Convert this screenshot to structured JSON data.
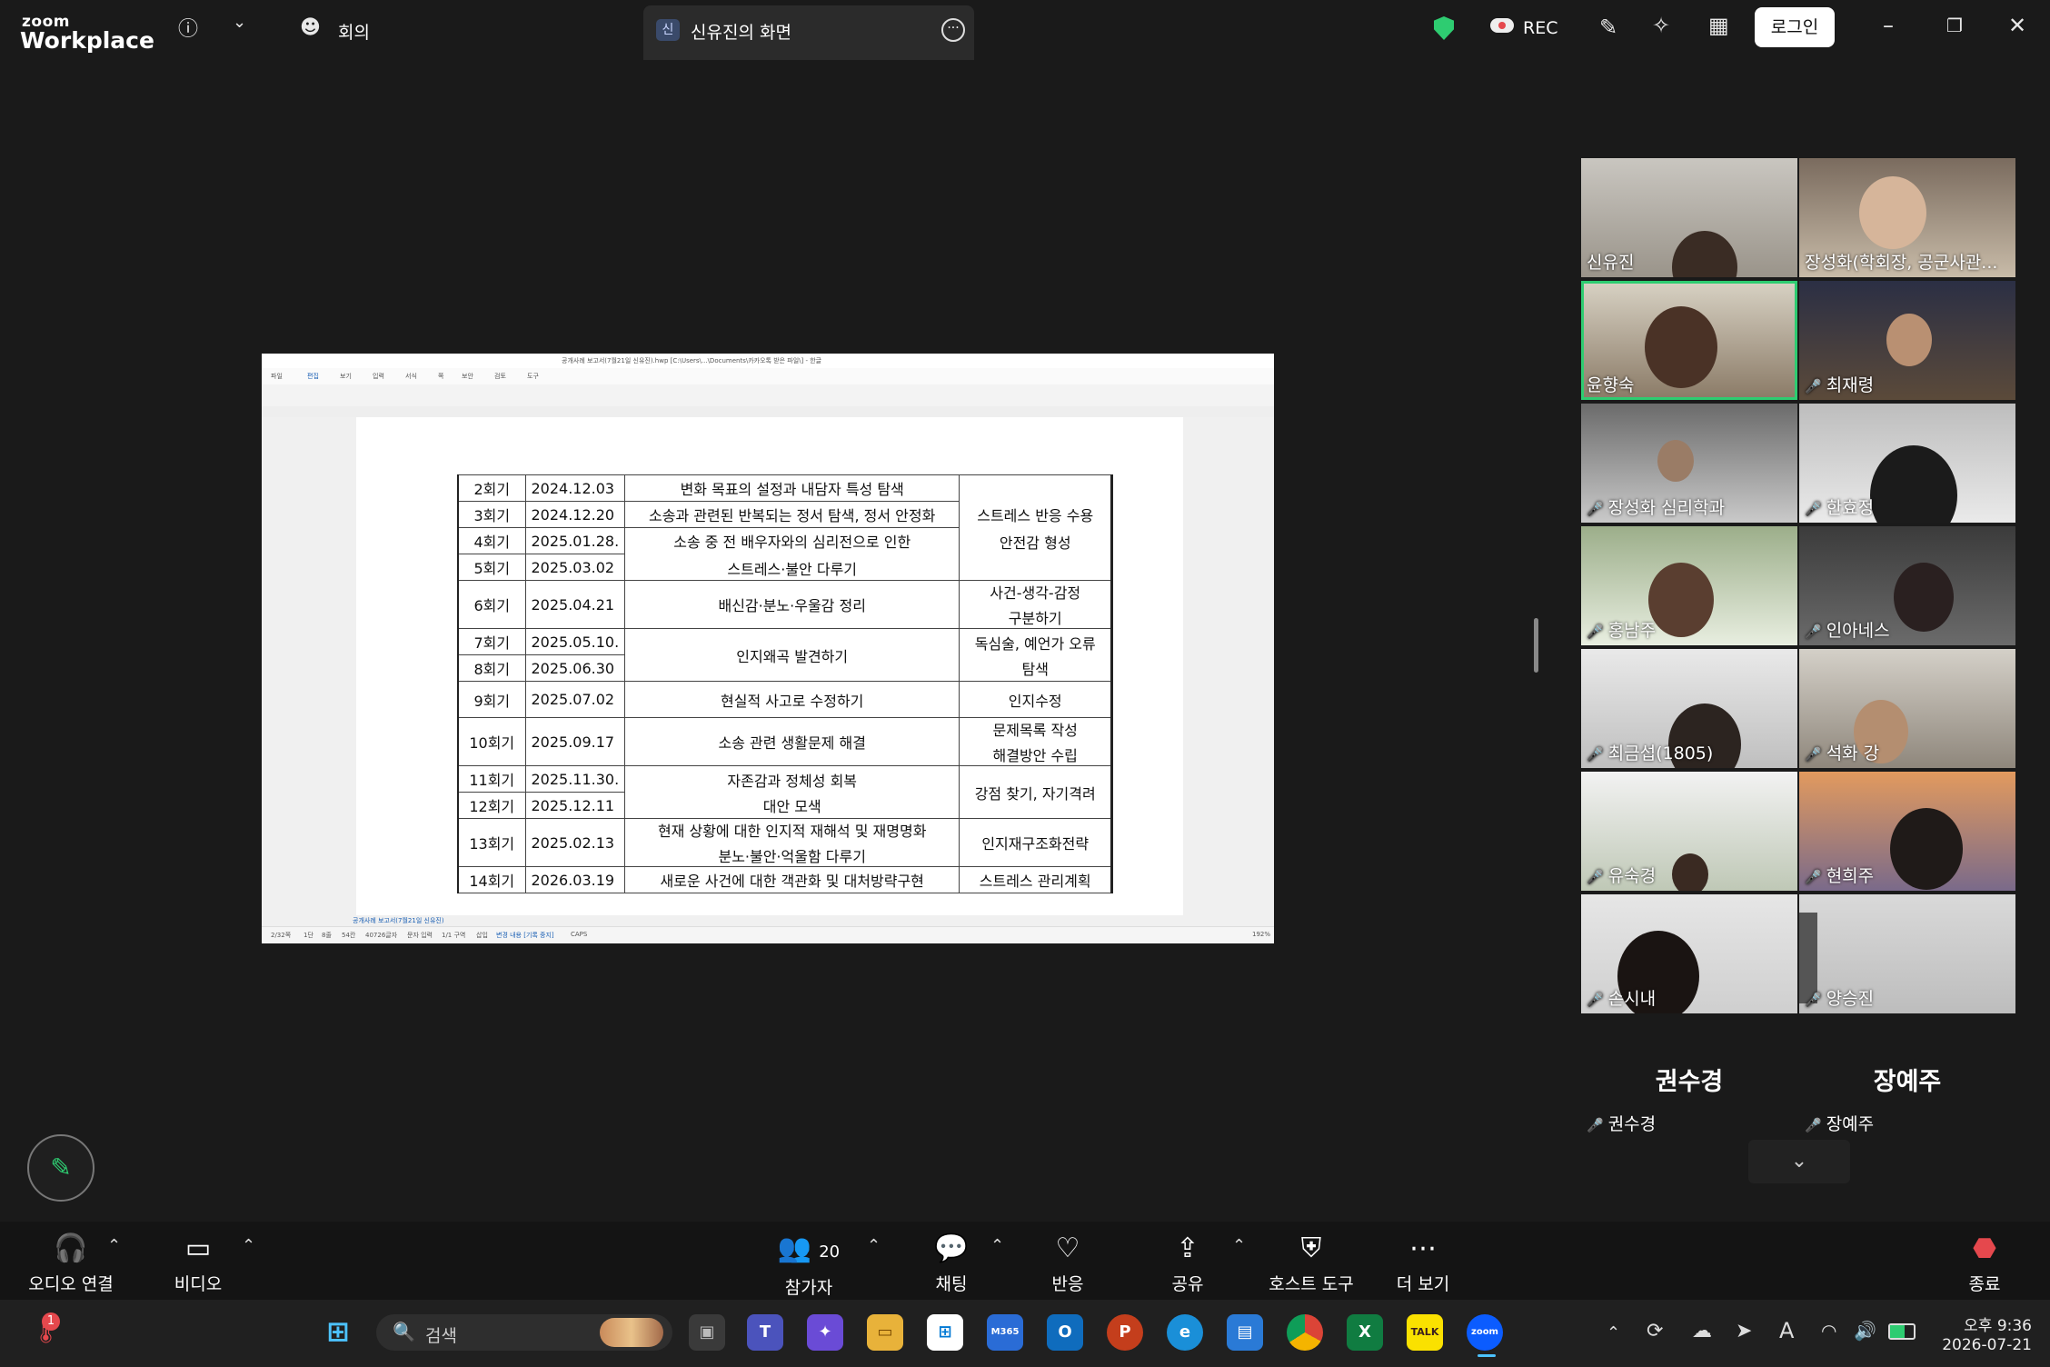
{
  "app": {
    "brand_top": "zoom",
    "brand_bottom": "Workplace"
  },
  "topbar": {
    "meeting_label": "회의",
    "share_tab_badge": "신",
    "share_tab_title": "신유진의 화면",
    "rec_label": "REC",
    "login_label": "로그인"
  },
  "document": {
    "title_bar": "공개사례 보고서(7월21일 신유진).hwp [C:\\Users\\...\\Documents\\카카오톡 받은 파일\\] - 한글",
    "menu": [
      "파일",
      "편집",
      "보기",
      "입력",
      "서식",
      "쪽",
      "보안",
      "검토",
      "도구"
    ],
    "sheet_tab": "공개사례 보고서(7월21일 신유진)",
    "status": [
      "2/32쪽",
      "1단",
      "8줄",
      "54칸",
      "40726글자",
      "문자 입력",
      "1/1 구역",
      "삽입",
      "변경 내용 [기록 중지]",
      "CAPS"
    ],
    "zoom": "192%",
    "rows": [
      {
        "session": "2회기",
        "date": "2024.12.03",
        "content": "변화 목표의 설정과 내담자 특성 탐색"
      },
      {
        "session": "3회기",
        "date": "2024.12.20",
        "content": "소송과 관련된 반복되는 정서 탐색, 정서 안정화"
      },
      {
        "session": "4회기",
        "date": "2025.01.28.",
        "content": "소송 중 전 배우자와의 심리전으로 인한"
      },
      {
        "session": "5회기",
        "date": "2025.03.02",
        "content": "스트레스·불안 다루기"
      },
      {
        "session": "6회기",
        "date": "2025.04.21",
        "content": "배신감·분노·우울감 정리"
      },
      {
        "session": "7회기",
        "date": "2025.05.10.",
        "content": "인지왜곡 발견하기"
      },
      {
        "session": "8회기",
        "date": "2025.06.30",
        "content": ""
      },
      {
        "session": "9회기",
        "date": "2025.07.02",
        "content": "현실적 사고로 수정하기"
      },
      {
        "session": "10회기",
        "date": "2025.09.17",
        "content": "소송 관련 생활문제 해결"
      },
      {
        "session": "11회기",
        "date": "2025.11.30.",
        "content": "자존감과 정체성 회복"
      },
      {
        "session": "12회기",
        "date": "2025.12.11",
        "content": "대안 모색"
      },
      {
        "session": "13회기",
        "date": "2025.02.13",
        "content": "현재 상황에 대한 인지적 재해석 및 재명명화"
      },
      {
        "session": "",
        "date": "",
        "content": "분노·불안·억울함 다루기"
      },
      {
        "session": "14회기",
        "date": "2026.03.19",
        "content": "새로운 사건에 대한 객관화 및 대처방략구현"
      }
    ],
    "goals": {
      "g1a": "스트레스 반응 수용",
      "g1b": "안전감 형성",
      "g2a": "사건-생각-감정",
      "g2b": "구분하기",
      "g3a": "독심술, 예언가 오류",
      "g3b": "탐색",
      "g4": "인지수정",
      "g5a": "문제목록 작성",
      "g5b": "해결방안 수립",
      "g6": "강점 찾기, 자기격려",
      "g7": "인지재구조화전략",
      "g8": "스트레스 관리계획"
    }
  },
  "participants": [
    {
      "name": "신유진",
      "muted": false
    },
    {
      "name": "장성화(학회장, 공군사관...",
      "muted": false
    },
    {
      "name": "윤향숙",
      "muted": false
    },
    {
      "name": "최재령",
      "muted": true
    },
    {
      "name": "장성화 심리학과",
      "muted": true
    },
    {
      "name": "한효정",
      "muted": true
    },
    {
      "name": "홍남주",
      "muted": true
    },
    {
      "name": "인아네스",
      "muted": true
    },
    {
      "name": "최금섭(1805)",
      "muted": true
    },
    {
      "name": "석화 강",
      "muted": true
    },
    {
      "name": "유숙경",
      "muted": true
    },
    {
      "name": "현희주",
      "muted": true
    },
    {
      "name": "손시내",
      "muted": true
    },
    {
      "name": "양승진",
      "muted": true
    }
  ],
  "audio_only": [
    {
      "big": "권수경",
      "small": "권수경"
    },
    {
      "big": "장예주",
      "small": "장예주"
    }
  ],
  "controls": {
    "audio": "오디오 연결",
    "video": "비디오",
    "participants": "참가자",
    "participant_count": "20",
    "chat": "채팅",
    "reactions": "반응",
    "share": "공유",
    "host_tools": "호스트 도구",
    "more": "더 보기",
    "end": "종료"
  },
  "taskbar": {
    "search_placeholder": "검색",
    "notification_count": "1",
    "time": "오후 9:36",
    "date": "2026-07-21",
    "ime": "A"
  },
  "colors": {
    "accent_green": "#2ecc71",
    "mute_red": "#e5484d",
    "end_red": "#e5484d"
  }
}
